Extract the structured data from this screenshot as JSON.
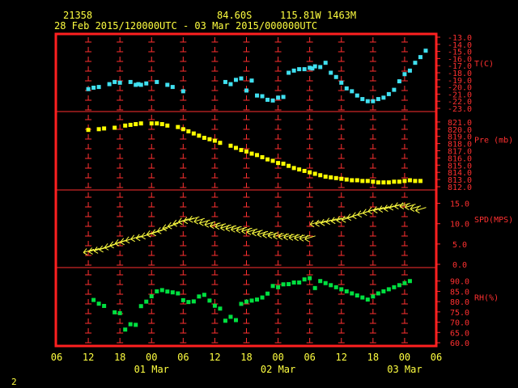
{
  "header": {
    "station": "21358",
    "lat": "84.60S",
    "lon": "115.81W",
    "elev": "1463M",
    "period": "28 Feb 2015/120000UTC - 03 Mar 2015/000000UTC"
  },
  "corner_label": "2",
  "colors": {
    "frame": "#ff2020",
    "text": "#ffff40",
    "temp": "#40e0f0",
    "pres": "#ffff00",
    "wind": "#ffff40",
    "rh": "#00e040",
    "axis_red": "#ff3030",
    "background": "#000000"
  },
  "chart_data": {
    "type": "scatter",
    "x_unit": "hours from 28 Feb 2015 06:00 UTC",
    "x_ticks": [
      "06",
      "12",
      "18",
      "00",
      "06",
      "12",
      "18",
      "00",
      "06",
      "12",
      "18",
      "00",
      "06"
    ],
    "x_day_labels": [
      {
        "label": "01 Mar",
        "at_tick": 3
      },
      {
        "label": "02 Mar",
        "at_tick": 7
      },
      {
        "label": "03 Mar",
        "at_tick": 11
      }
    ],
    "panels": [
      {
        "name": "T(C)",
        "ylim": [
          -23,
          -13
        ],
        "yticks": [
          "-13.0",
          "-14.0",
          "-15.0",
          "-16.0",
          "-17.0",
          "-18.0",
          "-19.0",
          "-20.0",
          "-21.0",
          "-22.0",
          "-23.0"
        ],
        "series": [
          {
            "x": [
              6,
              7,
              8,
              10,
              11,
              12,
              14,
              15,
              15.5,
              16,
              17,
              19,
              21,
              22,
              24,
              32,
              33,
              34,
              35,
              36,
              37,
              38,
              39,
              40,
              41,
              42,
              43,
              44,
              45,
              46,
              47,
              48,
              48.5,
              49,
              50,
              51,
              52,
              53,
              54,
              55,
              56,
              57,
              58,
              59,
              60,
              61,
              62,
              63,
              64,
              65,
              66,
              67,
              68,
              69,
              70
            ],
            "y": [
              -20.3,
              -20.1,
              -20.0,
              -19.6,
              -19.3,
              -19.4,
              -19.3,
              -19.7,
              -19.6,
              -19.7,
              -19.5,
              -19.3,
              -19.7,
              -20.0,
              -20.6,
              -19.3,
              -19.6,
              -19.0,
              -18.8,
              -20.5,
              -19.1,
              -21.2,
              -21.3,
              -21.8,
              -21.9,
              -21.5,
              -21.4,
              -18.0,
              -17.7,
              -17.5,
              -17.5,
              -17.3,
              -17.4,
              -17.1,
              -17.2,
              -16.6,
              -18.0,
              -18.6,
              -19.4,
              -20.2,
              -20.6,
              -21.2,
              -21.7,
              -22.0,
              -22.0,
              -21.7,
              -21.5,
              -21.0,
              -20.4,
              -19.2,
              -18.2,
              -17.7,
              -16.6,
              -15.8,
              -14.9
            ]
          }
        ]
      },
      {
        "name": "Pre (mb)",
        "ylim": [
          812,
          822
        ],
        "yticks": [
          "821.0",
          "820.0",
          "819.0",
          "818.0",
          "817.0",
          "816.0",
          "815.0",
          "814.0",
          "813.0",
          "812.0"
        ],
        "series": [
          {
            "x": [
              6,
              8,
              9,
              11,
              13,
              14,
              15,
              16,
              18,
              19,
              20,
              21,
              23,
              24,
              25,
              26,
              27,
              28,
              29,
              30,
              31,
              33,
              34,
              35,
              36,
              37,
              38,
              39,
              40,
              41,
              42,
              43,
              44,
              45,
              46,
              47,
              48,
              49,
              50,
              51,
              52,
              53,
              54,
              55,
              56,
              57,
              58,
              59,
              60,
              61,
              62,
              63,
              64,
              65,
              66,
              67,
              68,
              69
            ],
            "y": [
              819.9,
              820.0,
              820.1,
              820.2,
              820.5,
              820.6,
              820.7,
              820.8,
              820.8,
              820.8,
              820.7,
              820.5,
              820.3,
              820.0,
              819.7,
              819.4,
              819.1,
              818.8,
              818.6,
              818.4,
              818.1,
              817.7,
              817.4,
              817.1,
              816.9,
              816.6,
              816.4,
              816.1,
              815.8,
              815.6,
              815.3,
              815.2,
              814.9,
              814.6,
              814.4,
              814.2,
              814.0,
              813.8,
              813.6,
              813.4,
              813.3,
              813.2,
              813.1,
              813.0,
              812.9,
              812.9,
              812.8,
              812.8,
              812.7,
              812.6,
              812.6,
              812.6,
              812.7,
              812.7,
              812.8,
              812.9,
              812.8,
              812.8
            ]
          }
        ]
      },
      {
        "name": "SPD(MPS)",
        "ylim": [
          0,
          17.5
        ],
        "yticks": [
          "15.0",
          "10.0",
          "5.0",
          "0.0"
        ],
        "series": [
          {
            "x": [
              6,
              7,
              8,
              9,
              10,
              11,
              12,
              13,
              14,
              15,
              16,
              17,
              18,
              19,
              20,
              21,
              22,
              23,
              24,
              25,
              26,
              27,
              28,
              29,
              30,
              31,
              32,
              33,
              34,
              35,
              36,
              37,
              38,
              39,
              40,
              41,
              42,
              43,
              44,
              45,
              46,
              47,
              48,
              49,
              50,
              51,
              52,
              53,
              54,
              55,
              56,
              57,
              58,
              59,
              60,
              61,
              62,
              63,
              64,
              65,
              66,
              67,
              68,
              69
            ],
            "y": [
              3.3,
              3.5,
              3.7,
              4.0,
              4.5,
              5.0,
              5.5,
              5.8,
              6.2,
              6.6,
              6.8,
              7.2,
              7.7,
              8.0,
              8.5,
              9.2,
              9.7,
              10.3,
              10.8,
              11.0,
              11.3,
              10.9,
              10.5,
              10.1,
              9.8,
              9.6,
              9.3,
              9.1,
              8.9,
              8.7,
              8.5,
              8.3,
              8.0,
              7.7,
              7.5,
              7.4,
              7.2,
              7.1,
              7.0,
              6.9,
              6.8,
              6.7,
              6.6,
              10.2,
              10.3,
              10.5,
              10.8,
              11.0,
              11.2,
              11.3,
              11.8,
              12.2,
              12.6,
              13.0,
              13.4,
              13.6,
              13.8,
              14.0,
              14.3,
              14.6,
              14.6,
              14.4,
              14.0,
              13.6
            ]
          }
        ]
      },
      {
        "name": "RH(%)",
        "ylim": [
          60,
          95
        ],
        "yticks": [
          "90.0",
          "85.0",
          "80.0",
          "75.0",
          "70.0",
          "65.0",
          "60.0"
        ],
        "series": [
          {
            "x": [
              7,
              8,
              9,
              11,
              12,
              13,
              14,
              15,
              16,
              17,
              18,
              19,
              20,
              21,
              22,
              23,
              24,
              25,
              26,
              27,
              28,
              29,
              30,
              31,
              32,
              33,
              34,
              35,
              36,
              37,
              38,
              39,
              40,
              41,
              42,
              43,
              44,
              45,
              46,
              47,
              48,
              49,
              50,
              51,
              52,
              53,
              54,
              55,
              56,
              57,
              58,
              59,
              60,
              61,
              62,
              63,
              64,
              65,
              66,
              67
            ],
            "y": [
              80.8,
              79.0,
              77.9,
              74.8,
              74.4,
              66.4,
              69.0,
              68.7,
              77.8,
              80.0,
              82.6,
              85.0,
              85.6,
              84.9,
              84.5,
              84.0,
              80.7,
              79.8,
              80.1,
              82.5,
              83.3,
              80.5,
              78.0,
              76.6,
              70.7,
              72.6,
              71.0,
              78.9,
              80.0,
              80.5,
              81.0,
              82.0,
              83.9,
              87.6,
              87.0,
              88.4,
              88.5,
              89.3,
              89.3,
              90.8,
              91.4,
              86.6,
              90.0,
              89.0,
              88.0,
              87.0,
              86.0,
              85.0,
              84.0,
              83.0,
              82.0,
              81.0,
              82.5,
              84.0,
              85.0,
              86.0,
              87.0,
              88.0,
              89.0,
              90.0
            ]
          }
        ]
      }
    ]
  }
}
